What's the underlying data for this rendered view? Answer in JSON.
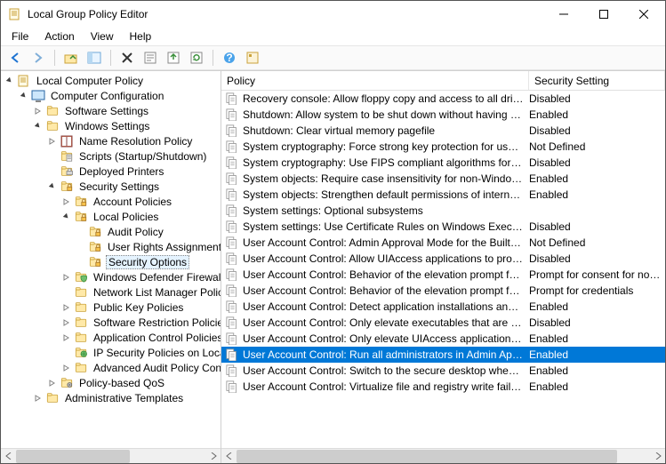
{
  "window": {
    "title": "Local Group Policy Editor"
  },
  "menu": {
    "file": "File",
    "action": "Action",
    "view": "View",
    "help": "Help"
  },
  "tree": {
    "root": "Local Computer Policy",
    "computer_config": "Computer Configuration",
    "software_settings": "Software Settings",
    "windows_settings": "Windows Settings",
    "name_resolution": "Name Resolution Policy",
    "scripts": "Scripts (Startup/Shutdown)",
    "deployed_printers": "Deployed Printers",
    "security_settings": "Security Settings",
    "account_policies": "Account Policies",
    "local_policies": "Local Policies",
    "audit_policy": "Audit Policy",
    "user_rights": "User Rights Assignment",
    "security_options": "Security Options",
    "windows_defender": "Windows Defender Firewall with Advanced Security",
    "network_list": "Network List Manager Policies",
    "public_key": "Public Key Policies",
    "software_restriction": "Software Restriction Policies",
    "application_control": "Application Control Policies",
    "ip_security": "IP Security Policies on Local Computer",
    "advanced_audit": "Advanced Audit Policy Configuration",
    "policy_qos": "Policy-based QoS",
    "admin_templates": "Administrative Templates"
  },
  "columns": {
    "policy": "Policy",
    "setting": "Security Setting"
  },
  "policies": [
    {
      "name": "Recovery console: Allow floppy copy and access to all drives...",
      "setting": "Disabled"
    },
    {
      "name": "Shutdown: Allow system to be shut down without having to...",
      "setting": "Enabled"
    },
    {
      "name": "Shutdown: Clear virtual memory pagefile",
      "setting": "Disabled"
    },
    {
      "name": "System cryptography: Force strong key protection for user k...",
      "setting": "Not Defined"
    },
    {
      "name": "System cryptography: Use FIPS compliant algorithms for en...",
      "setting": "Disabled"
    },
    {
      "name": "System objects: Require case insensitivity for non-Windows ...",
      "setting": "Enabled"
    },
    {
      "name": "System objects: Strengthen default permissions of internal s...",
      "setting": "Enabled"
    },
    {
      "name": "System settings: Optional subsystems",
      "setting": ""
    },
    {
      "name": "System settings: Use Certificate Rules on Windows Executab...",
      "setting": "Disabled"
    },
    {
      "name": "User Account Control: Admin Approval Mode for the Built-i...",
      "setting": "Not Defined"
    },
    {
      "name": "User Account Control: Allow UIAccess applications to prom...",
      "setting": "Disabled"
    },
    {
      "name": "User Account Control: Behavior of the elevation prompt for ...",
      "setting": "Prompt for consent for non-Windows binaries"
    },
    {
      "name": "User Account Control: Behavior of the elevation prompt for ...",
      "setting": "Prompt for credentials"
    },
    {
      "name": "User Account Control: Detect application installations and p...",
      "setting": "Enabled"
    },
    {
      "name": "User Account Control: Only elevate executables that are sig...",
      "setting": "Disabled"
    },
    {
      "name": "User Account Control: Only elevate UIAccess applications th...",
      "setting": "Enabled"
    },
    {
      "name": "User Account Control: Run all administrators in Admin Appr...",
      "setting": "Enabled",
      "selected": true
    },
    {
      "name": "User Account Control: Switch to the secure desktop when pr...",
      "setting": "Enabled"
    },
    {
      "name": "User Account Control: Virtualize file and registry write failure...",
      "setting": "Enabled"
    }
  ]
}
